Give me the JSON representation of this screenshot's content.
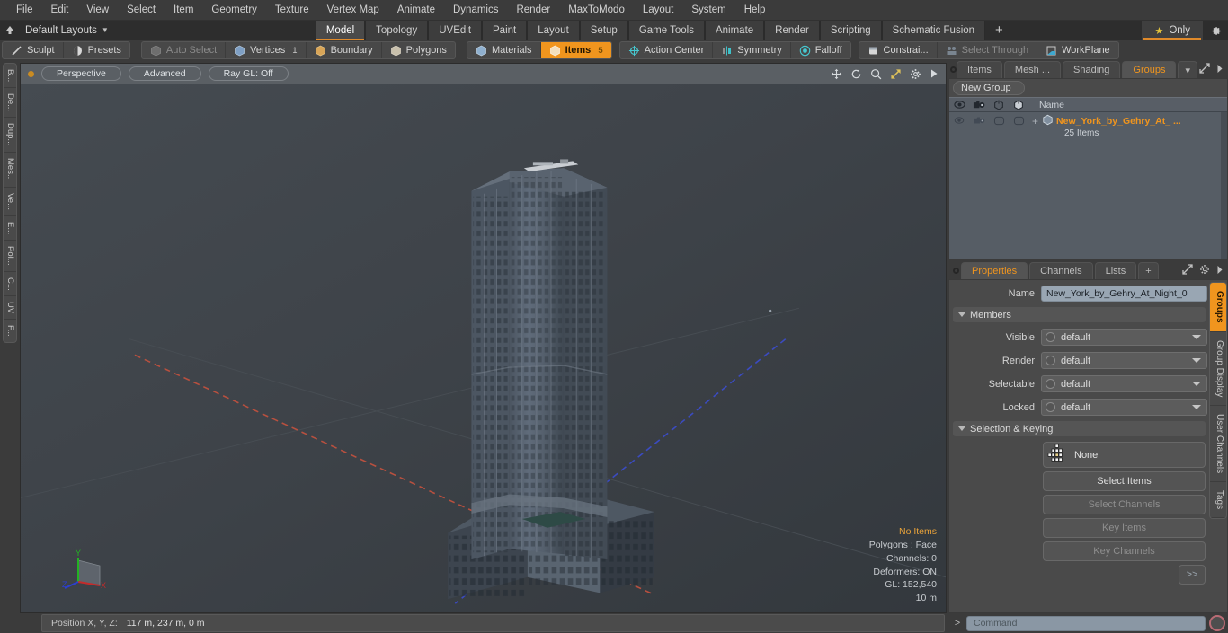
{
  "menubar": {
    "items": [
      "File",
      "Edit",
      "View",
      "Select",
      "Item",
      "Geometry",
      "Texture",
      "Vertex Map",
      "Animate",
      "Dynamics",
      "Render",
      "MaxToModo",
      "Layout",
      "System",
      "Help"
    ]
  },
  "layoutbar": {
    "home_icon": "home-icon",
    "layout_name": "Default Layouts",
    "tabs": [
      {
        "label": "Model",
        "active": true
      },
      {
        "label": "Topology",
        "active": false
      },
      {
        "label": "UVEdit",
        "active": false
      },
      {
        "label": "Paint",
        "active": false
      },
      {
        "label": "Layout",
        "active": false
      },
      {
        "label": "Setup",
        "active": false
      },
      {
        "label": "Game Tools",
        "active": false
      },
      {
        "label": "Animate",
        "active": false
      },
      {
        "label": "Render",
        "active": false
      },
      {
        "label": "Scripting",
        "active": false
      },
      {
        "label": "Schematic Fusion",
        "active": false
      }
    ],
    "add_tab": "+",
    "only_label": "Only",
    "star_icon": "star-icon",
    "gear_icon": "gear-icon"
  },
  "toolbar": {
    "group1": [
      {
        "label": "Sculpt",
        "icon": "sculpt-icon",
        "state": "normal"
      },
      {
        "label": "Presets",
        "icon": "presets-icon",
        "state": "normal"
      }
    ],
    "group2": [
      {
        "label": "Auto Select",
        "icon": "cube-gray-icon",
        "state": "dim",
        "count": ""
      },
      {
        "label": "Vertices",
        "icon": "cube-blue-icon",
        "state": "normal",
        "count": "1"
      },
      {
        "label": "Boundary",
        "icon": "cube-orange-icon",
        "state": "normal",
        "count": ""
      },
      {
        "label": "Polygons",
        "icon": "cube-tan-icon",
        "state": "normal",
        "count": ""
      }
    ],
    "group3": [
      {
        "label": "Materials",
        "icon": "cube-blue-icon",
        "state": "normal",
        "count": ""
      },
      {
        "label": "Items",
        "icon": "cube-white-icon",
        "state": "selected",
        "count": "5"
      }
    ],
    "group4": [
      {
        "label": "Action Center",
        "icon": "action-center-icon",
        "state": "normal"
      },
      {
        "label": "Symmetry",
        "icon": "symmetry-icon",
        "state": "normal"
      },
      {
        "label": "Falloff",
        "icon": "falloff-icon",
        "state": "normal"
      }
    ],
    "group5": [
      {
        "label": "Constrai...",
        "icon": "constraint-icon",
        "state": "normal"
      },
      {
        "label": "Select Through",
        "icon": "select-through-icon",
        "state": "dim"
      },
      {
        "label": "WorkPlane",
        "icon": "workplane-icon",
        "state": "normal"
      }
    ]
  },
  "left_tabs": [
    "B...",
    "De...",
    "Dup...",
    "Mes...",
    "Ve...",
    "E...",
    "Pol...",
    "C...",
    "UV",
    "F..."
  ],
  "viewport": {
    "dot_color": "#c98b22",
    "pills": [
      "Perspective",
      "Advanced",
      "Ray GL: Off"
    ],
    "header_icons": [
      "move-icon",
      "rotate-icon",
      "zoom-icon",
      "fit-icon",
      "gear-icon",
      "play-icon"
    ],
    "stats": [
      {
        "text": "No Items",
        "highlight": true
      },
      {
        "text": "Polygons : Face",
        "highlight": false
      },
      {
        "text": "Channels: 0",
        "highlight": false
      },
      {
        "text": "Deformers: ON",
        "highlight": false
      },
      {
        "text": "GL: 152,540",
        "highlight": false
      },
      {
        "text": "10 m",
        "highlight": false
      }
    ],
    "gizmo": {
      "x": "X",
      "y": "Y",
      "z": "Z"
    }
  },
  "statusbar": {
    "label": "Position X, Y, Z:",
    "value": "117 m, 237 m, 0 m"
  },
  "right_panel": {
    "tabs": [
      {
        "label": "Items",
        "active": false
      },
      {
        "label": "Mesh ...",
        "active": false
      },
      {
        "label": "Shading",
        "active": false
      },
      {
        "label": "Groups",
        "active": true
      }
    ],
    "caret": "▾",
    "expand_icon": "expand-icon",
    "arrow_icon": "arrow-right-icon",
    "new_group_button": "New Group",
    "list_header": {
      "columns": [
        "eye-icon",
        "render-icon",
        "cube-outline-icon",
        "cube-solid-icon"
      ],
      "name_label": "Name"
    },
    "list_rows": [
      {
        "name": "New_York_by_Gehry_At_ ...",
        "sub": "25 Items",
        "expand": "+",
        "item_icon": "group-cube-icon"
      }
    ]
  },
  "properties": {
    "tabs": [
      {
        "label": "Properties",
        "active": true
      },
      {
        "label": "Channels",
        "active": false
      },
      {
        "label": "Lists",
        "active": false
      },
      {
        "label": "+",
        "active": false
      }
    ],
    "gear_icon": "gear-icon",
    "expand_icon": "expand-icon",
    "arrow_icon": "arrow-right-icon",
    "name_label": "Name",
    "name_value": "New_York_by_Gehry_At_Night_0",
    "members_section": "Members",
    "member_rows": [
      {
        "label": "Visible",
        "value": "default"
      },
      {
        "label": "Render",
        "value": "default"
      },
      {
        "label": "Selectable",
        "value": "default"
      },
      {
        "label": "Locked",
        "value": "default"
      }
    ],
    "selection_section": "Selection & Keying",
    "none_button": "None",
    "sk_buttons": [
      {
        "label": "Select Items",
        "enabled": true
      },
      {
        "label": "Select Channels",
        "enabled": false
      },
      {
        "label": "Key Items",
        "enabled": false
      },
      {
        "label": "Key Channels",
        "enabled": false
      }
    ],
    "forward_button": ">>"
  },
  "right_tabs": [
    {
      "label": "Groups",
      "active": true
    },
    {
      "label": "Group Display",
      "active": false
    },
    {
      "label": "User Channels",
      "active": false
    },
    {
      "label": "Tags",
      "active": false
    }
  ],
  "command_bar": {
    "caret": ">",
    "placeholder": "Command",
    "record_icon": "record-icon"
  },
  "colors": {
    "accent": "#f0951e",
    "viewport_bg": "#3e4348",
    "panel_bg": "#4a4a4a",
    "axis_x": "#b24a3c",
    "axis_z": "#3a49b0",
    "building": "#5a6470"
  }
}
